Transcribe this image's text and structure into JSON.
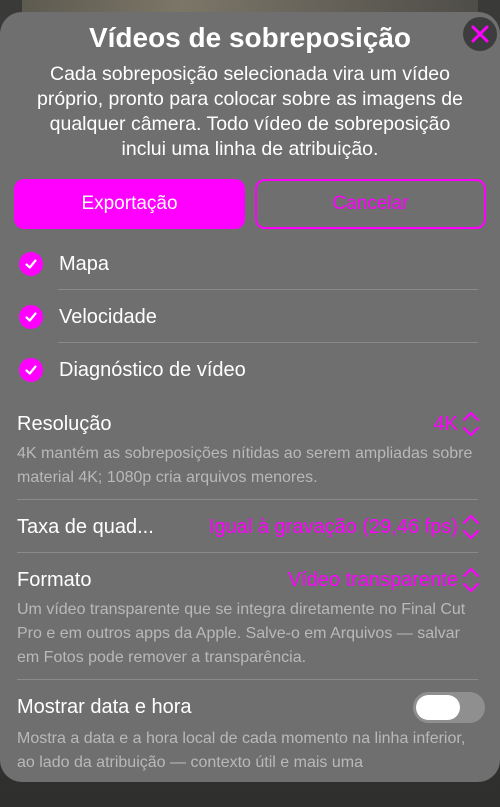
{
  "dialog": {
    "title": "Vídeos de sobreposição",
    "description": "Cada sobreposição selecionada vira um vídeo próprio, pronto para colocar sobre as imagens de qualquer câmera. Todo vídeo de sobreposição inclui uma linha de atribuição."
  },
  "actions": {
    "export_label": "Exportação",
    "cancel_label": "Cancelar"
  },
  "overlays": [
    {
      "label": "Mapa",
      "checked": true
    },
    {
      "label": "Velocidade",
      "checked": true
    },
    {
      "label": "Diagnóstico de vídeo",
      "checked": true
    }
  ],
  "settings": {
    "resolution": {
      "label": "Resolução",
      "value": "4K",
      "description": "4K mantém as sobreposições nítidas ao serem ampliadas sobre material 4K; 1080p cria arquivos menores."
    },
    "frame_rate": {
      "label": "Taxa de quad...",
      "value": "Igual à gravação (29,46 fps)"
    },
    "format": {
      "label": "Formato",
      "value": "Vídeo transparente",
      "description": "Um vídeo transparente que se integra diretamente no Final Cut Pro e em outros apps da Apple. Salve-o em Arquivos — salvar em Fotos pode remover a transparência."
    },
    "show_datetime": {
      "label": "Mostrar data e hora",
      "enabled": false,
      "description": "Mostra a data e a hora local de cada momento na linha inferior, ao lado da atribuição — contexto útil e mais uma"
    }
  },
  "colors": {
    "accent": "#ff00ff",
    "sheet_bg": "#6f6f6f",
    "secondary_text": "#b9b9b9"
  }
}
